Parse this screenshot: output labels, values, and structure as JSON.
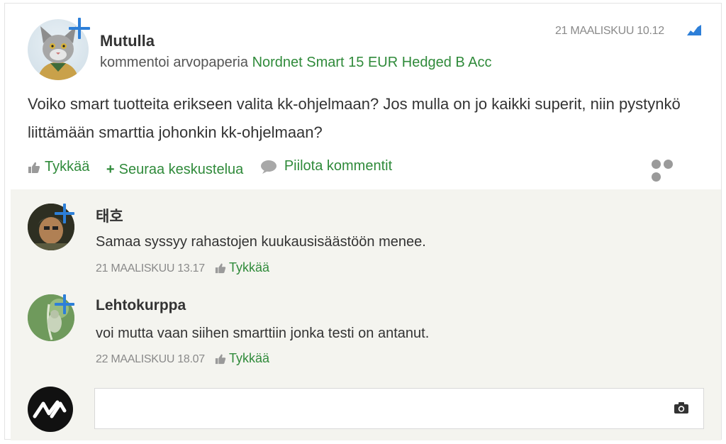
{
  "post": {
    "author": "Mutulla",
    "action_prefix": "kommentoi arvopaperia",
    "security_link": "Nordnet Smart 15 EUR Hedged B Acc",
    "timestamp": "21 MAALISKUU 10.12",
    "body": "Voiko smart tuotteita erikseen valita kk-ohjelmaan? Jos mulla on jo kaikki superit, niin pystynkö liittämään smarttia johonkin kk-ohjelmaan?",
    "actions": {
      "like": "Tykkää",
      "follow": "Seuraa keskustelua",
      "hide_comments": "Piilota kommentit"
    }
  },
  "comments": [
    {
      "author": "태호",
      "text": "Samaa syssyy rahastojen kuukausisäästöön menee.",
      "timestamp": "21 MAALISKUU 13.17",
      "like": "Tykkää"
    },
    {
      "author": "Lehtokurppa",
      "text": "voi mutta vaan siihen smarttiin jonka testi on antanut.",
      "timestamp": "22 MAALISKUU 18.07",
      "like": "Tykkää"
    }
  ],
  "composer": {
    "placeholder": "",
    "camera_icon": "camera-icon"
  },
  "colors": {
    "link_green": "#2f8a3a",
    "follow_blue": "#2d7fd8",
    "comment_bg": "#f4f4ef"
  }
}
